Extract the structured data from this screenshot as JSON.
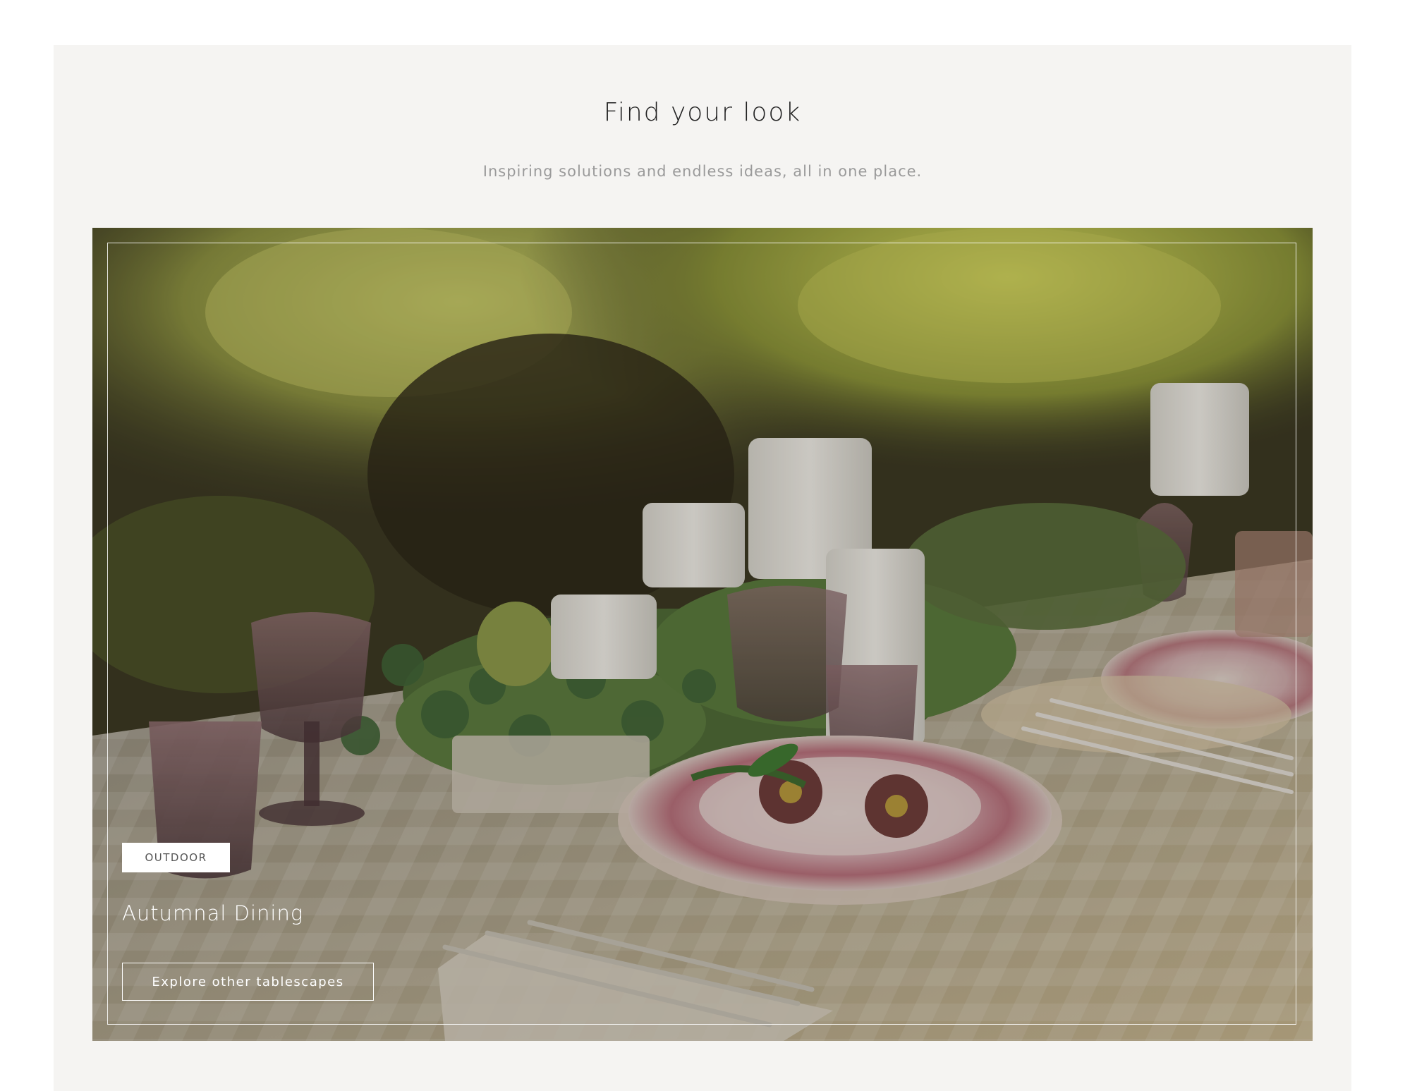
{
  "section": {
    "title": "Find your look",
    "subtitle": "Inspiring solutions and endless ideas, all in one place."
  },
  "feature_card": {
    "tag": "OUTDOOR",
    "title": "Autumnal Dining",
    "button_label": "Explore other tablescapes",
    "image_description_icon": "tablescape-photo"
  },
  "colors": {
    "panel_background": "#f5f4f2",
    "heading_text": "#222222",
    "subtitle_text": "#9a9a9a",
    "overlay_text": "#ffffff"
  }
}
